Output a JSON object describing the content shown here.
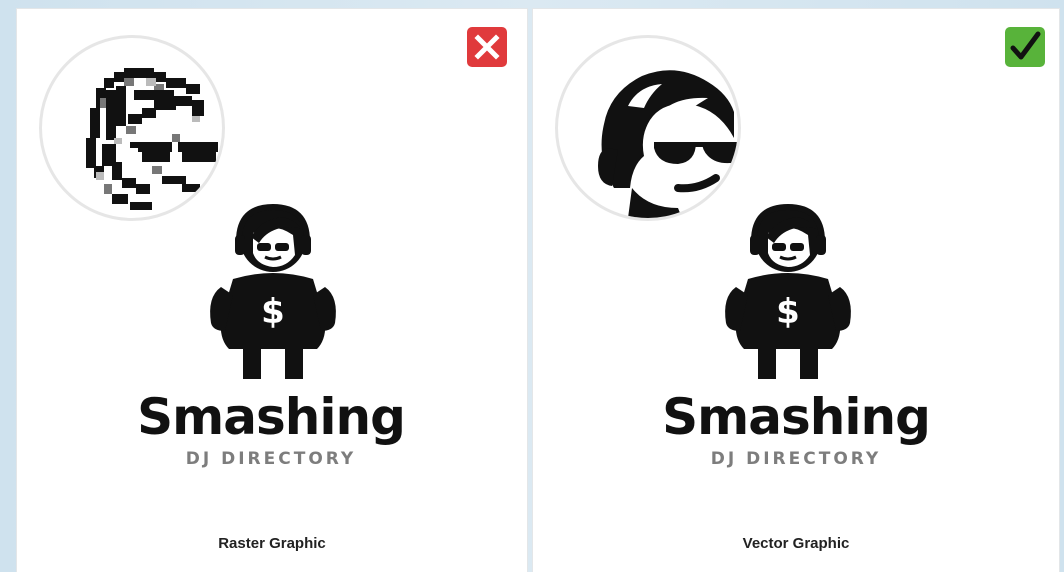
{
  "panels": [
    {
      "status_icon": "close-icon",
      "status_color": "#e03a3c",
      "brand_name": "Smashing",
      "brand_subtitle": "DJ DIRECTORY",
      "caption": "Raster Graphic"
    },
    {
      "status_icon": "check-icon",
      "status_color": "#58b33a",
      "brand_name": "Smashing",
      "brand_subtitle": "DJ DIRECTORY",
      "caption": "Vector Graphic"
    }
  ]
}
